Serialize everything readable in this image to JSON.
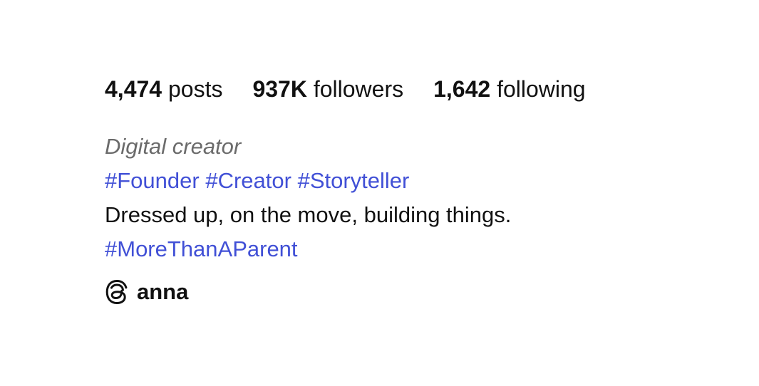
{
  "stats": {
    "posts": {
      "count": "4,474",
      "label": "posts"
    },
    "followers": {
      "count": "937K",
      "label": "followers"
    },
    "following": {
      "count": "1,642",
      "label": "following"
    }
  },
  "bio": {
    "category": "Digital creator",
    "hashtags_line": [
      "#Founder",
      "#Creator",
      "#Storyteller"
    ],
    "text": "Dressed up, on the move, building things.",
    "hashtag_extra": "#MoreThanAParent"
  },
  "threads_link": {
    "icon": "threads-icon",
    "username": "anna"
  },
  "colors": {
    "hashtag": "#4150d6",
    "category": "#6b6b6b",
    "text": "#111111"
  }
}
